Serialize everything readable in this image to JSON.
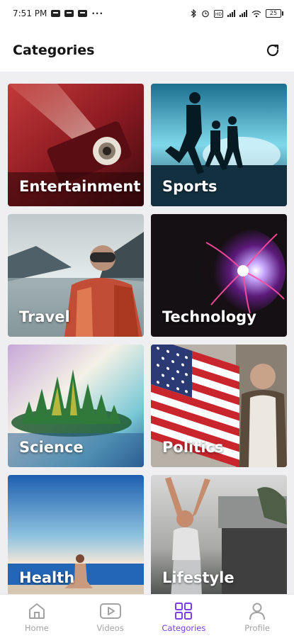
{
  "status_bar": {
    "time": "7:51 PM",
    "dots": "···",
    "battery": "25"
  },
  "header": {
    "title": "Categories",
    "refresh_icon": "refresh-icon"
  },
  "categories": [
    {
      "label": "Entertainment",
      "image": "projector"
    },
    {
      "label": "Sports",
      "image": "runners"
    },
    {
      "label": "Travel",
      "image": "hiker-lake"
    },
    {
      "label": "Technology",
      "image": "plasma-ball"
    },
    {
      "label": "Science",
      "image": "crystal-spikes"
    },
    {
      "label": "Politics",
      "image": "us-flag"
    },
    {
      "label": "Health",
      "image": "yoga-beach"
    },
    {
      "label": "Lifestyle",
      "image": "stretching-woman"
    }
  ],
  "bottom_nav": {
    "active": "Categories",
    "active_color": "#7a3fe4",
    "inactive_color": "#a3a3a3",
    "items": [
      {
        "label": "Home",
        "icon": "home-icon"
      },
      {
        "label": "Videos",
        "icon": "video-icon"
      },
      {
        "label": "Categories",
        "icon": "grid-icon"
      },
      {
        "label": "Profile",
        "icon": "user-icon"
      }
    ]
  }
}
